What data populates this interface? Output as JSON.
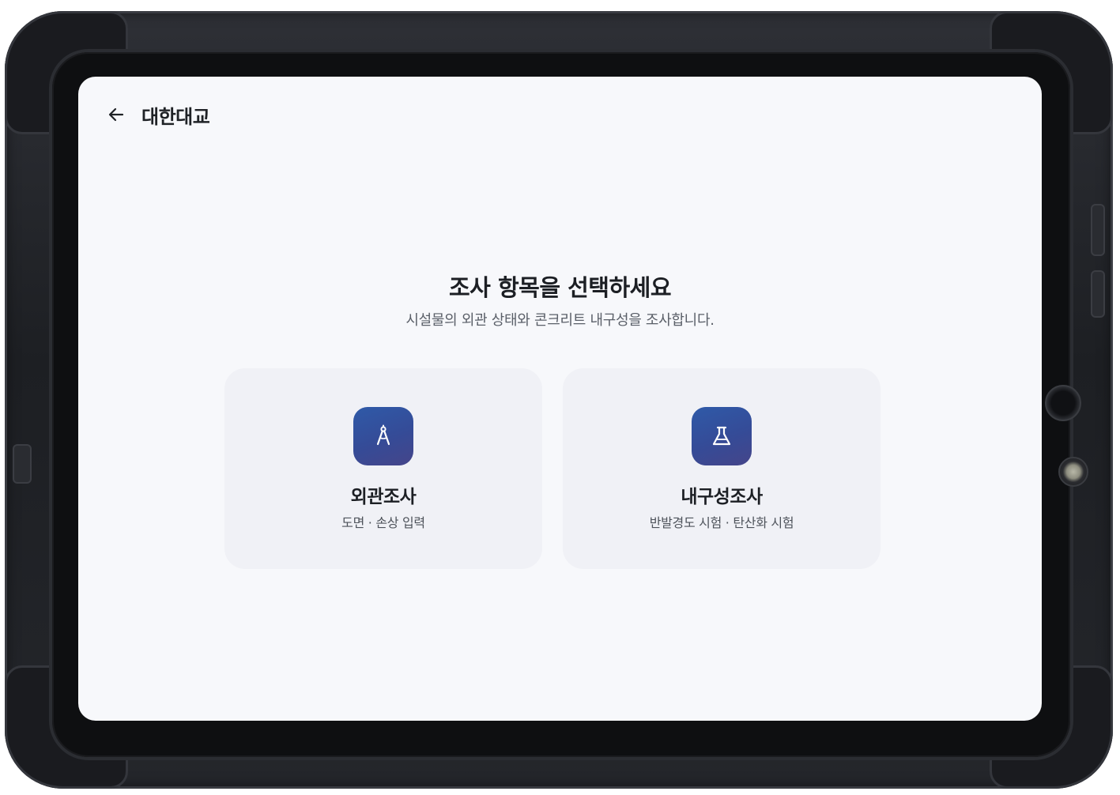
{
  "header": {
    "title": "대한대교",
    "back_icon": "arrow-left-icon"
  },
  "main": {
    "heading": "조사 항목을 선택하세요",
    "subheading": "시설물의 외관 상태와 콘크리트 내구성을 조사합니다."
  },
  "cards": [
    {
      "title": "외관조사",
      "description": "도면 · 손상 입력",
      "icon": "compass-drafting-icon"
    },
    {
      "title": "내구성조사",
      "description": "반발경도 시험 · 탄산화 시험",
      "icon": "flask-icon"
    }
  ],
  "colors": {
    "screen_background": "#f7f8fb",
    "card_background": "#f0f1f6",
    "icon_gradient_start": "#2f5aa8",
    "icon_gradient_end": "#45458a",
    "text_primary": "#1c1f24",
    "text_secondary": "#5a5f68"
  }
}
